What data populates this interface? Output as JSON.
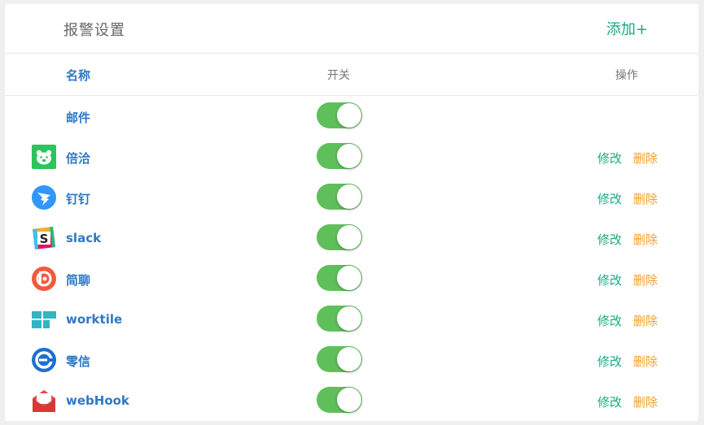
{
  "header": {
    "title": "报警设置",
    "add_label": "添加+"
  },
  "columns": {
    "name": "名称",
    "switch": "开关",
    "ops": "操作"
  },
  "rows": [
    {
      "name": "邮件",
      "icon": "none",
      "enabled": true,
      "edit": "",
      "delete": ""
    },
    {
      "name": "倍洽",
      "icon": "bearychat-icon",
      "enabled": true,
      "edit": "修改",
      "delete": "删除"
    },
    {
      "name": "钉钉",
      "icon": "dingtalk-icon",
      "enabled": true,
      "edit": "修改",
      "delete": "删除"
    },
    {
      "name": "slack",
      "icon": "slack-icon",
      "enabled": true,
      "edit": "修改",
      "delete": "删除"
    },
    {
      "name": "简聊",
      "icon": "jianliao-icon",
      "enabled": true,
      "edit": "修改",
      "delete": "删除"
    },
    {
      "name": "worktile",
      "icon": "worktile-icon",
      "enabled": true,
      "edit": "修改",
      "delete": "删除"
    },
    {
      "name": "零信",
      "icon": "pubu-icon",
      "enabled": true,
      "edit": "修改",
      "delete": "删除"
    },
    {
      "name": "webHook",
      "icon": "webhook-mail-icon",
      "enabled": true,
      "edit": "修改",
      "delete": "删除"
    }
  ],
  "colors": {
    "accent_green": "#1aab80",
    "toggle_on": "#5fc05b",
    "link_blue": "#2f78c4",
    "delete_orange": "#f0a024"
  }
}
